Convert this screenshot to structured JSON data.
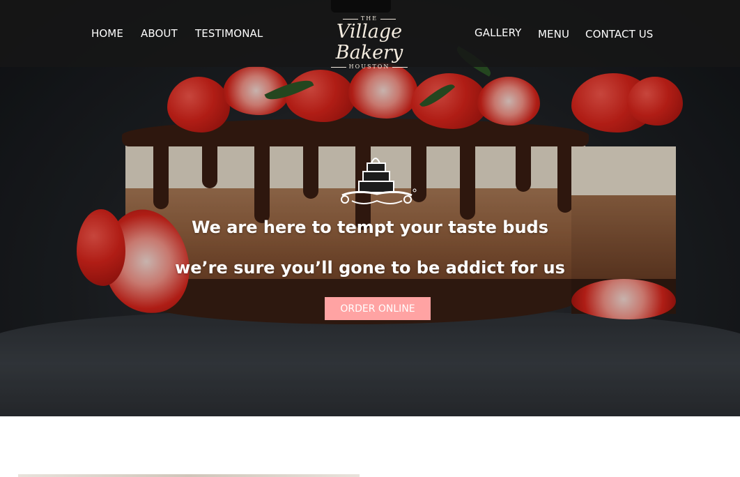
{
  "nav": {
    "left_links": [
      "HOME",
      "ABOUT",
      "TESTIMONAL"
    ],
    "right_links": [
      "GALLERY",
      "MENU",
      "CONTACT US"
    ]
  },
  "logo": {
    "top_text": "THE",
    "name": "Village Bakery",
    "bottom_text": "HOUSTON"
  },
  "hero": {
    "headline_1": "We are here to tempt your taste buds",
    "headline_2": "we’re sure you’ll gone to be addict for us",
    "cta_label": "ORDER ONLINE",
    "icon": "cake-stand-icon"
  },
  "colors": {
    "nav_bg": "#161616",
    "cta_bg": "#ffa3a3",
    "text": "#ffffff"
  }
}
